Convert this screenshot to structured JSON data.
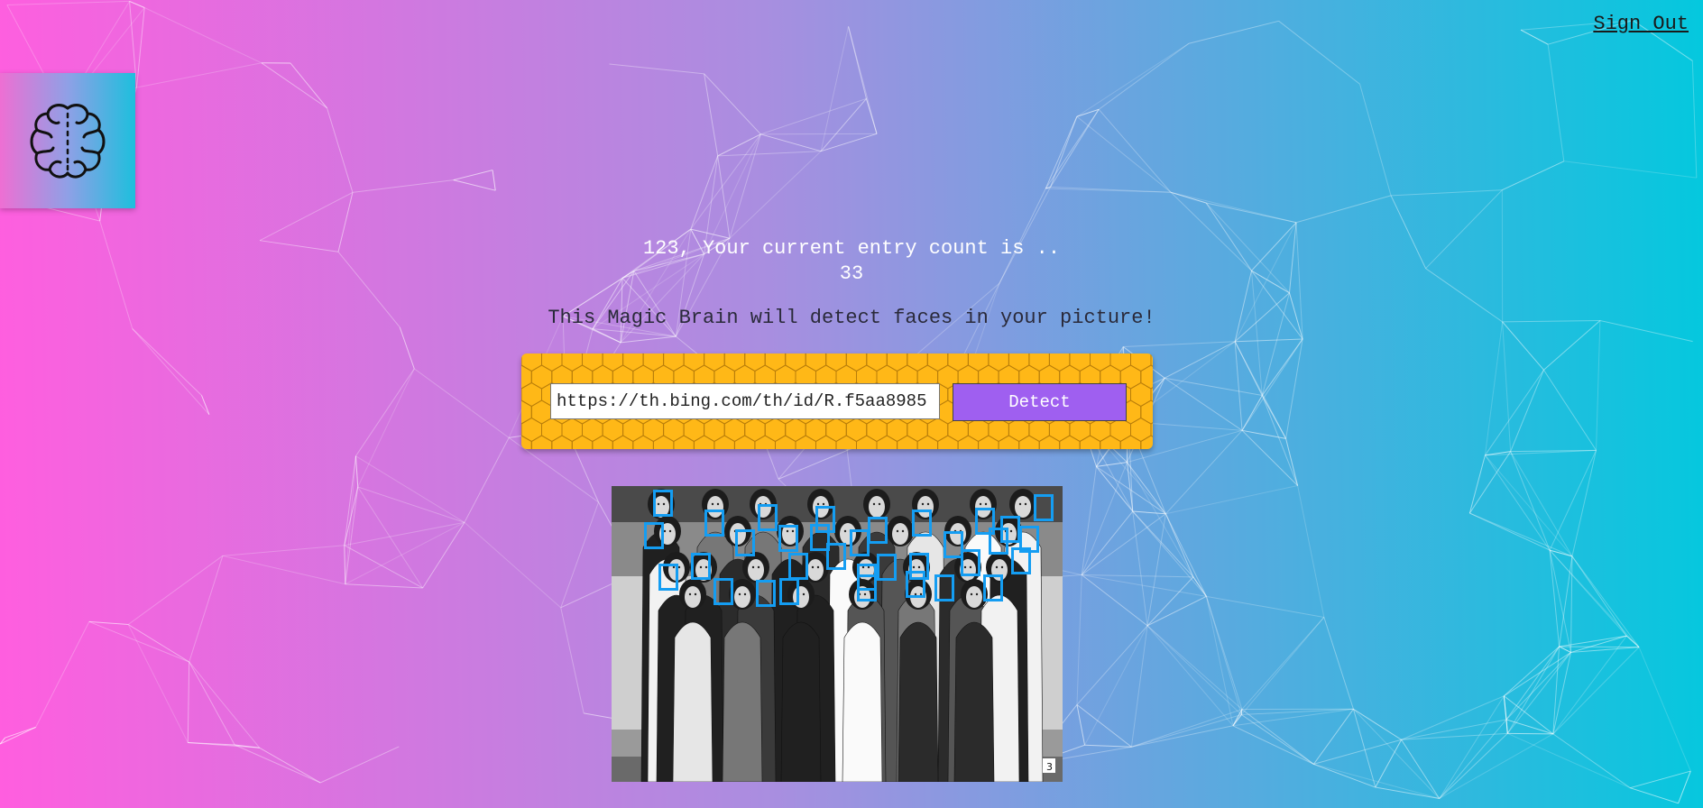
{
  "header": {
    "signout_label": "Sign Out"
  },
  "logo": {
    "icon": "brain-icon"
  },
  "greeting": {
    "line1": "123, Your current entry count is ..",
    "count": "33"
  },
  "tagline": "This Magic Brain will detect faces in your picture!",
  "form": {
    "url_value": "https://th.bing.com/th/id/R.f5aa8985",
    "detect_label": "Detect"
  },
  "result": {
    "faces_detected": 33,
    "photo_page_number": "3"
  },
  "colors": {
    "gradient_left": "#ff5edf",
    "gradient_mid": "#a98ee0",
    "gradient_right": "#04c8de",
    "panel_bg": "#ffb817",
    "button_bg": "#9f5ff0",
    "bounding_box": "#149df2"
  }
}
